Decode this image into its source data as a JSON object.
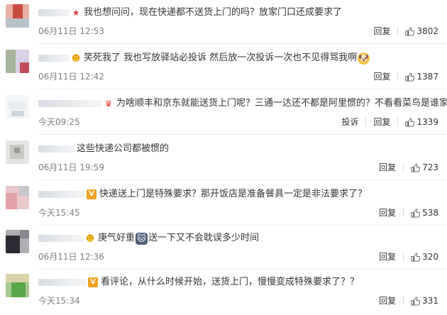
{
  "comments": [
    {
      "text": "我也想问问，现在快递都不送货上门的吗？放家门口还成要求了",
      "time": "06月11日 12:53",
      "reply": "回复",
      "likes": "3802",
      "report": "",
      "badge": "star-icon",
      "badge_glyph": "★",
      "avatar_colors": [
        "#c94a3f",
        "#e7b0a3",
        "#b9c2c9"
      ]
    },
    {
      "text": "笑死我了 我也写放驿站必投诉 然后放一次投诉一次也不见得骂我啊",
      "time": "06月11日 12:42",
      "reply": "回复",
      "likes": "1387",
      "report": "",
      "badge": "smile-face-icon",
      "badge_glyph": "☻",
      "avatar_colors": [
        "#a7b59a",
        "#d9cfe6",
        "#c14c58"
      ]
    },
    {
      "text": "为啥顺丰和京东就能送货上门呢？三通一达还不都是阿里惯的？不看看菜鸟是谁家的",
      "time": "今天09:25",
      "reply": "回复",
      "likes": "1339",
      "report": "投诉",
      "badge": "crown-icon",
      "badge_glyph": "♛",
      "avatar_colors": [
        "#e8ecef",
        "#cfd6dc",
        "#f4f5f7"
      ]
    },
    {
      "text": "这些快递公司都被惯的",
      "time": "06月11日 19:59",
      "reply": "回复",
      "likes": "723",
      "report": "",
      "badge": "",
      "badge_glyph": "",
      "avatar_colors": [
        "#9b9b98",
        "#c7c7c3",
        "#e4e4e0"
      ]
    },
    {
      "text": "快递送上门是特殊要求？那开饭店是准备餐具一定是非法要求了？",
      "time": "今天15:45",
      "reply": "回复",
      "likes": "538",
      "report": "",
      "badge": "vip-icon",
      "badge_glyph": "V",
      "avatar_colors": [
        "#e2a2a8",
        "#e9c9cb",
        "#c9c6cc"
      ]
    },
    {
      "text": "庚气好重",
      "text2": "送一下又不会耽误多少时间",
      "time": "06月11日 12:36",
      "reply": "回复",
      "likes": "320",
      "report": "",
      "badge": "smile-face-icon",
      "badge_glyph": "☻",
      "avatar_colors": [
        "#2c2a33",
        "#8a8790",
        "#b0adb5"
      ]
    },
    {
      "text": "看评论，从什么时候开始，送货上门，慢慢变成特殊要求了？？",
      "time": "今天15:34",
      "reply": "回复",
      "likes": "331",
      "report": "",
      "badge": "vip-icon",
      "badge_glyph": "V",
      "avatar_colors": [
        "#5aa74a",
        "#d9d2a8",
        "#a7c98f"
      ]
    }
  ],
  "emoji": {
    "dog": "🐶",
    "cat": "🐱"
  },
  "colors": {
    "meta": "#808080",
    "text": "#333333",
    "divider": "#eeeeee"
  }
}
